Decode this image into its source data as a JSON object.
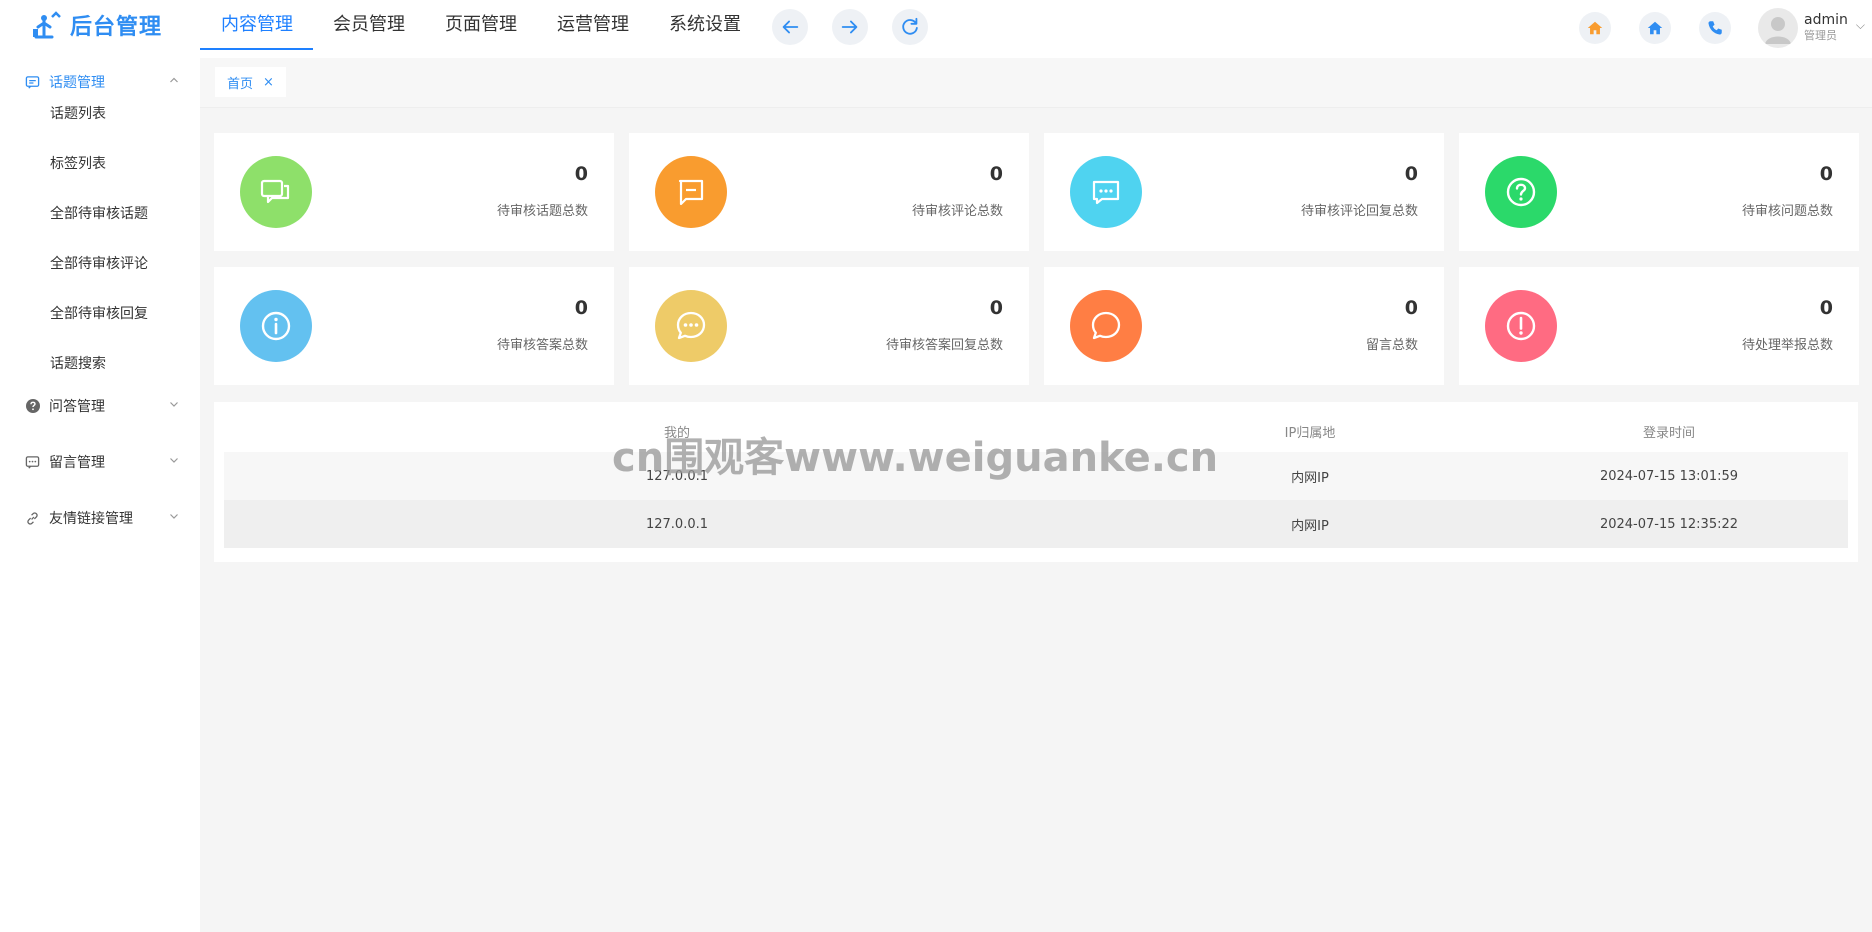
{
  "brand": {
    "name": "后台管理"
  },
  "topnav": {
    "items": [
      {
        "label": "内容管理",
        "active": true
      },
      {
        "label": "会员管理",
        "active": false
      },
      {
        "label": "页面管理",
        "active": false
      },
      {
        "label": "运营管理",
        "active": false
      },
      {
        "label": "系统设置",
        "active": false
      }
    ],
    "actions": [
      "back-arrow-icon",
      "forward-arrow-icon",
      "refresh-icon"
    ]
  },
  "header_icons": [
    "home-icon-orange",
    "home-icon-blue",
    "phone-icon"
  ],
  "user": {
    "name": "admin",
    "role": "管理员"
  },
  "sidebar": {
    "groups": [
      {
        "label": "话题管理",
        "icon": "chat-square-icon",
        "open": true,
        "items": [
          "话题列表",
          "标签列表",
          "全部待审核话题",
          "全部待审核评论",
          "全部待审核回复",
          "话题搜索"
        ]
      },
      {
        "label": "问答管理",
        "icon": "question-circle-icon",
        "open": false,
        "items": []
      },
      {
        "label": "留言管理",
        "icon": "message-dots-icon",
        "open": false,
        "items": []
      },
      {
        "label": "友情链接管理",
        "icon": "link-icon",
        "open": false,
        "items": []
      }
    ]
  },
  "tabs": [
    {
      "label": "首页",
      "close": "×"
    }
  ],
  "stats": [
    {
      "value": "0",
      "label": "待审核话题总数",
      "color": "#8ee06a",
      "icon": "chat-bubbles-icon"
    },
    {
      "value": "0",
      "label": "待审核评论总数",
      "color": "#f99c2f",
      "icon": "comment-icon"
    },
    {
      "value": "0",
      "label": "待审核评论回复总数",
      "color": "#4fd3f0",
      "icon": "chat-dots-icon"
    },
    {
      "value": "0",
      "label": "待审核问题总数",
      "color": "#2bd96a",
      "icon": "question-icon"
    },
    {
      "value": "0",
      "label": "待审核答案总数",
      "color": "#63c1f0",
      "icon": "info-icon"
    },
    {
      "value": "0",
      "label": "待审核答案回复总数",
      "color": "#eecb68",
      "icon": "ellipsis-bubble-icon"
    },
    {
      "value": "0",
      "label": "留言总数",
      "color": "#ff7e44",
      "icon": "speech-bubble-icon"
    },
    {
      "value": "0",
      "label": "待处理举报总数",
      "color": "#ff6b82",
      "icon": "alert-icon"
    }
  ],
  "login_table": {
    "columns": [
      "我的",
      "IP归属地",
      "登录时间"
    ],
    "rows": [
      [
        "127.0.0.1",
        "内网IP",
        "2024-07-15 13:01:59"
      ],
      [
        "127.0.0.1",
        "内网IP",
        "2024-07-15 12:35:22"
      ]
    ]
  },
  "watermark": "cn围观客www.weiguanke.cn",
  "colors": {
    "accent": "#2f8df2",
    "nav_active": "#1e80ff"
  }
}
